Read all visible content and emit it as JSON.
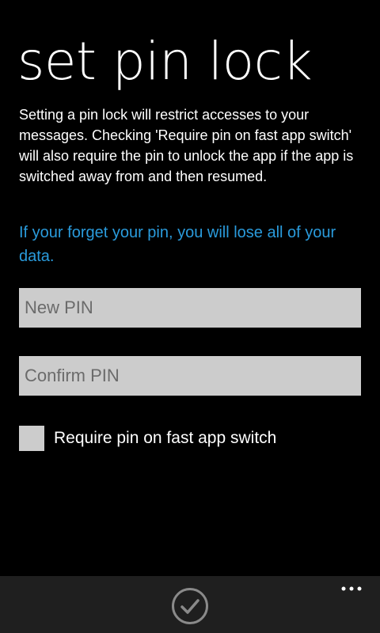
{
  "page": {
    "title": "set pin lock",
    "description": "Setting a pin lock will restrict accesses to your messages. Checking 'Require pin on fast app switch' will also require the pin to unlock the app if the app is switched away from and then resumed.",
    "warning": "If your forget your pin, you will lose all of your data."
  },
  "form": {
    "new_pin": {
      "placeholder": "New PIN",
      "value": ""
    },
    "confirm_pin": {
      "placeholder": "Confirm PIN",
      "value": ""
    },
    "fast_app_switch": {
      "label": "Require pin on fast app switch",
      "checked": false
    }
  },
  "app_bar": {
    "buttons": [
      {
        "icon": "check-icon"
      },
      {
        "icon": "more-icon"
      }
    ]
  },
  "colors": {
    "background": "#000000",
    "accent": "#2a9bdc",
    "field_background": "#cccccc",
    "app_bar_background": "#1f1f1f"
  }
}
